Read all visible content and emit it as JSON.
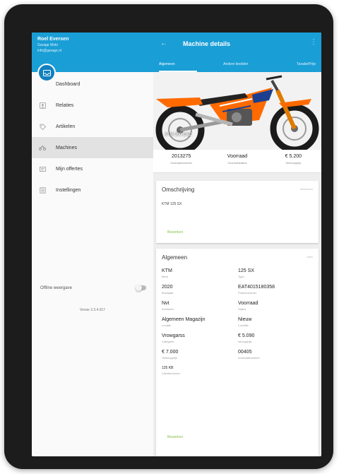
{
  "drawer": {
    "user_name": "Roel Eversen",
    "user_line_1": "Garage Moto",
    "user_line_2": "info@garage.nl",
    "nav": [
      {
        "icon": "dashboard-icon",
        "label": "Dashboard",
        "active": false
      },
      {
        "icon": "contacts-icon",
        "label": "Relaties",
        "active": false
      },
      {
        "icon": "tag-icon",
        "label": "Artikelen",
        "active": false
      },
      {
        "icon": "motorbike-icon",
        "label": "Machines",
        "active": true
      },
      {
        "icon": "offers-icon",
        "label": "Mijn offertes",
        "active": false
      },
      {
        "icon": "settings-icon",
        "label": "Instellingen",
        "active": false
      }
    ],
    "offline_label": "Offline weergave",
    "version": "Versie 2.3.4.917"
  },
  "appbar": {
    "title": "Machine details",
    "tabs": [
      "Algemeen",
      "Andere beelden",
      "Taxatie/Prijs"
    ]
  },
  "hero": {
    "label": "KTM 300 EXC"
  },
  "stats": [
    {
      "value": "2013275",
      "label": "Voorraadnummer"
    },
    {
      "value": "Voorraad",
      "label": "Voorraadstatus"
    },
    {
      "value": "€ 5.200",
      "label": "Verkoopprijs"
    }
  ],
  "description": {
    "title": "Omschrijving",
    "action": "Bewerken",
    "text": "KTM 125 SX",
    "button": "Bewerken"
  },
  "general": {
    "title": "Algemeen",
    "action": "Alles",
    "fields": [
      {
        "value": "KTM",
        "label": "Merk"
      },
      {
        "value": "125 SX",
        "label": "Type"
      },
      {
        "value": "2020",
        "label": "Bouwjaar"
      },
      {
        "value": "EAT4015180358",
        "label": "Framenummer"
      },
      {
        "value": "Nvt",
        "label": "Kenteken"
      },
      {
        "value": "Voorraad",
        "label": "Status"
      },
      {
        "value": "Algemeen Magazijn",
        "label": "Locatie"
      },
      {
        "value": "Nieuw",
        "label": "Conditie"
      },
      {
        "value": "Vrowgarss",
        "label": "Categorie"
      },
      {
        "value": "€ 5.090",
        "label": "Inkoopprijs"
      },
      {
        "value": "€ 7.000",
        "label": "Verkoopprijs"
      },
      {
        "value": "00405",
        "label": "Voorraadnummer"
      },
      {
        "value": "125 KB",
        "label": "Cilinderinhoud"
      }
    ],
    "button": "Bewerken"
  },
  "colors": {
    "primary": "#1a9ed6",
    "accent": "#8bc34a",
    "bike_orange": "#ff6a00"
  }
}
